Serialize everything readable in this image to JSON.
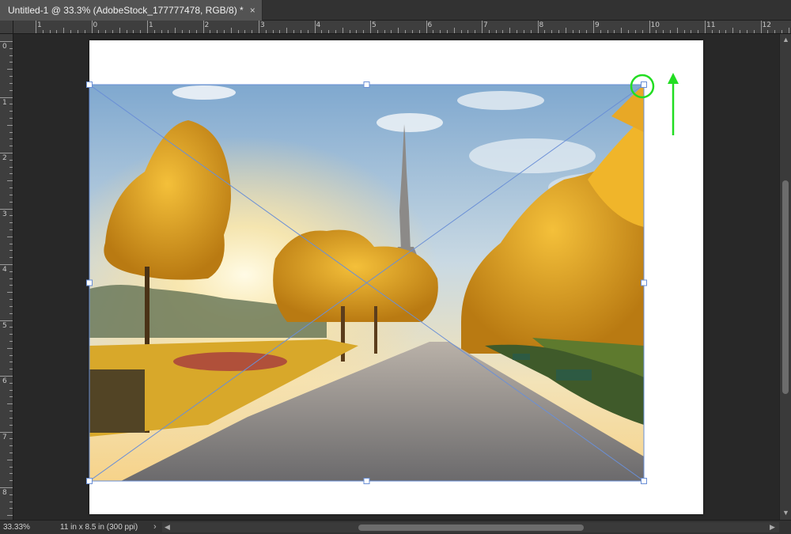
{
  "document": {
    "tab_title": "Untitled-1 @ 33.3% (AdobeStock_177777478, RGB/8) *",
    "close_glyph": "×"
  },
  "rulers": {
    "horizontal_labels": [
      "1",
      "0",
      "1",
      "2",
      "3",
      "4",
      "5",
      "6",
      "7",
      "8",
      "9",
      "10",
      "11",
      "12"
    ],
    "vertical_labels": [
      "0",
      "1",
      "2",
      "3",
      "4",
      "5",
      "6",
      "7",
      "8"
    ]
  },
  "status": {
    "zoom": "33.33%",
    "doc_info": "11 in x 8.5 in (300 ppi)",
    "info_arrow": "›"
  },
  "scroll": {
    "vertical_fraction_start": 0.3,
    "vertical_fraction_size": 0.44,
    "horizontal_fraction_start": 0.32,
    "horizontal_fraction_size": 0.37
  },
  "annotations": {
    "highlight_color": "#22dd22",
    "bounding_box_color": "#6a8fd6"
  },
  "icons": {
    "scroll_up": "chevron-up-icon",
    "scroll_down": "chevron-down-icon",
    "scroll_left": "chevron-left-icon",
    "scroll_right": "chevron-right-icon"
  }
}
